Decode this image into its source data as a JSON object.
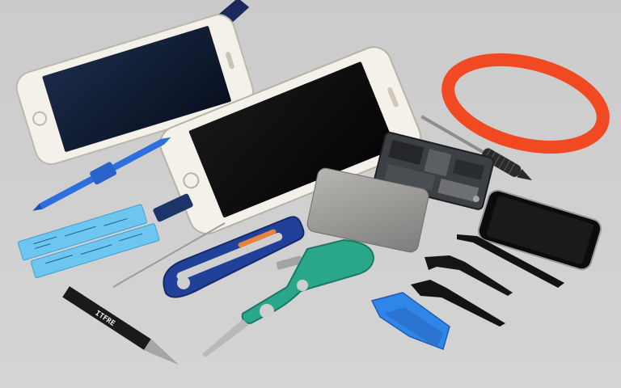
{
  "scene": {
    "background_color": "#cfcfcf",
    "knife_logo_text": "ITFRE",
    "tape_strip_upper_text": "",
    "tape_strip_lower_text": ""
  },
  "items": [
    {
      "name": "phone-display-top-left",
      "color": "#0c1a33"
    },
    {
      "name": "phone-white-center",
      "color": "#f3f1e9"
    },
    {
      "name": "orange-suction-ring",
      "color": "#f14a22"
    },
    {
      "name": "screwdriver",
      "color": "#2b2b2b"
    },
    {
      "name": "logic-board",
      "color": "#3c3f44"
    },
    {
      "name": "metal-card",
      "color": "#9a9a98"
    },
    {
      "name": "black-phone",
      "color": "#0b0b0d"
    },
    {
      "name": "blue-pry-pen",
      "color": "#2e6fe0"
    },
    {
      "name": "blue-tape-strips",
      "color": "#6cc6f0"
    },
    {
      "name": "blue-handle-pliers",
      "color": "#21409a"
    },
    {
      "name": "teal-tweezers",
      "color": "#2aa68b"
    },
    {
      "name": "precision-knife",
      "color": "#1a1a1a"
    },
    {
      "name": "black-pry-tools",
      "color": "#121212"
    },
    {
      "name": "blue-opening-picks",
      "color": "#2f86e8"
    }
  ]
}
